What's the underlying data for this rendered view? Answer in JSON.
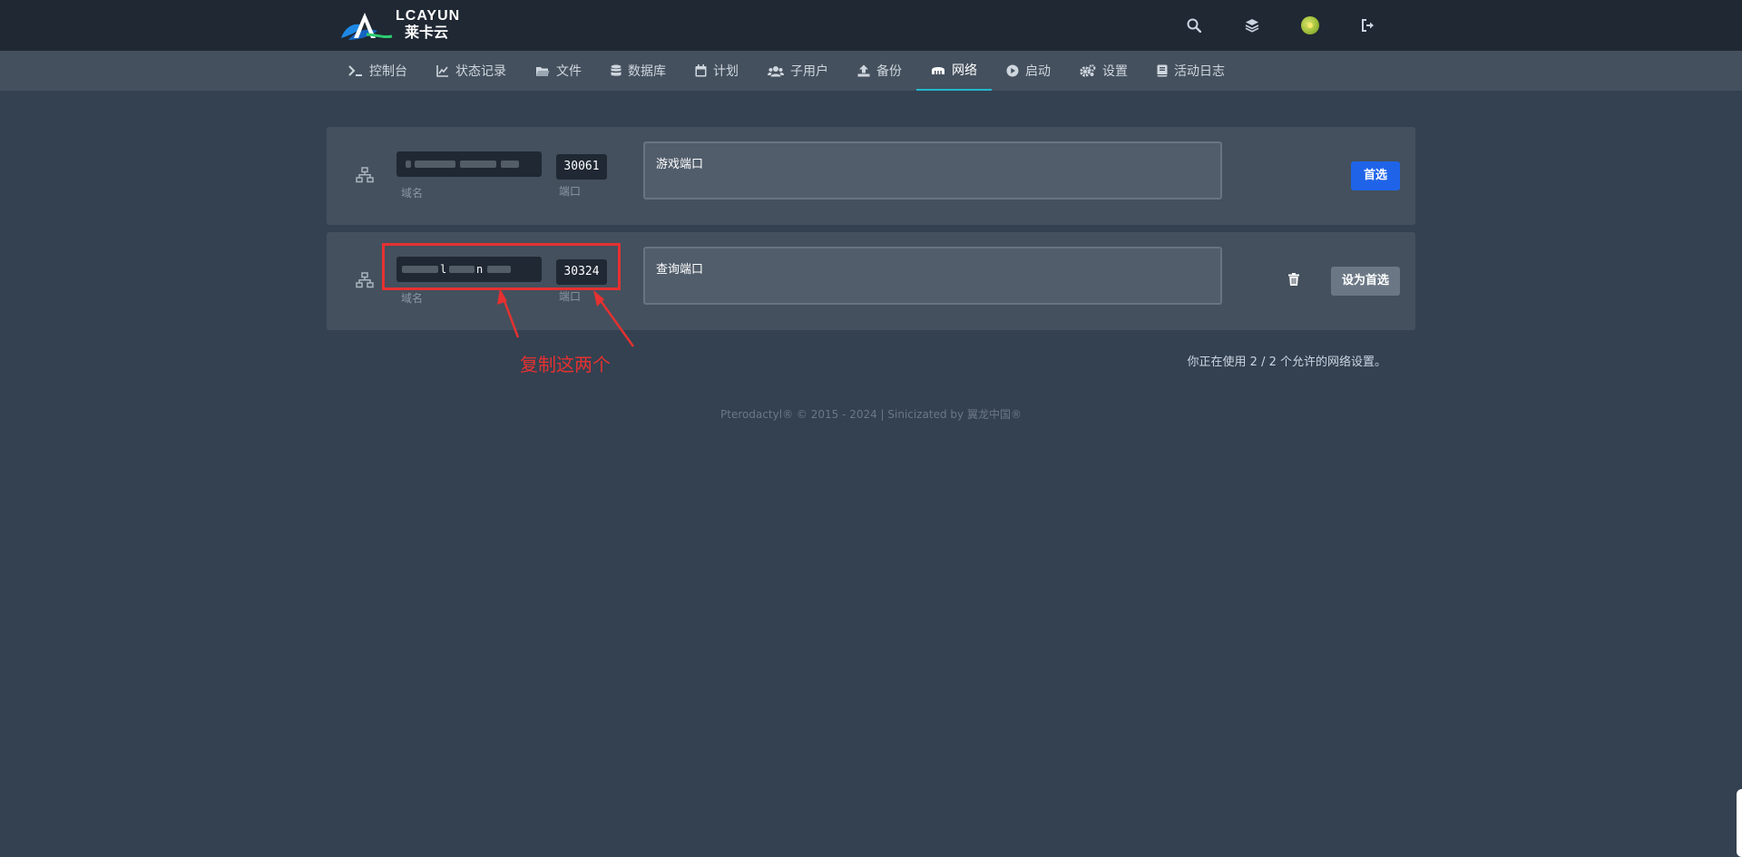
{
  "header": {
    "logo_text": "LCAYUN",
    "logo_subtext": "莱卡云",
    "icons": [
      "search-icon",
      "layers-icon",
      "avatar",
      "logout-icon"
    ]
  },
  "tabs": [
    {
      "label": "控制台",
      "icon": "terminal-icon"
    },
    {
      "label": "状态记录",
      "icon": "chart-icon"
    },
    {
      "label": "文件",
      "icon": "folder-icon"
    },
    {
      "label": "数据库",
      "icon": "database-icon"
    },
    {
      "label": "计划",
      "icon": "calendar-icon"
    },
    {
      "label": "子用户",
      "icon": "users-icon"
    },
    {
      "label": "备份",
      "icon": "upload-icon"
    },
    {
      "label": "网络",
      "icon": "network-icon",
      "active": true
    },
    {
      "label": "启动",
      "icon": "play-icon"
    },
    {
      "label": "设置",
      "icon": "cogs-icon"
    },
    {
      "label": "活动日志",
      "icon": "book-icon"
    }
  ],
  "allocations": [
    {
      "ip_label": "域名",
      "port": "30061",
      "port_label": "端口",
      "notes": "游戏端口",
      "button": "首选"
    },
    {
      "ip_visible": "l",
      "ip_visible_2": "n",
      "ip_label": "域名",
      "port": "30324",
      "port_label": "端口",
      "notes": "查询端口",
      "button": "设为首选"
    }
  ],
  "usage_text": "你正在使用 2 / 2 个允许的网络设置。",
  "footer": "Pterodactyl® © 2015 - 2024 | Sinicizated by 翼龙中国®",
  "annotation": {
    "text": "复制这两个",
    "color": "#e53131"
  },
  "colors": {
    "background": "#334150",
    "header": "#1f2833",
    "nav": "#44505d",
    "accent": "#22b8cf",
    "primary_button": "#1f64e8"
  }
}
